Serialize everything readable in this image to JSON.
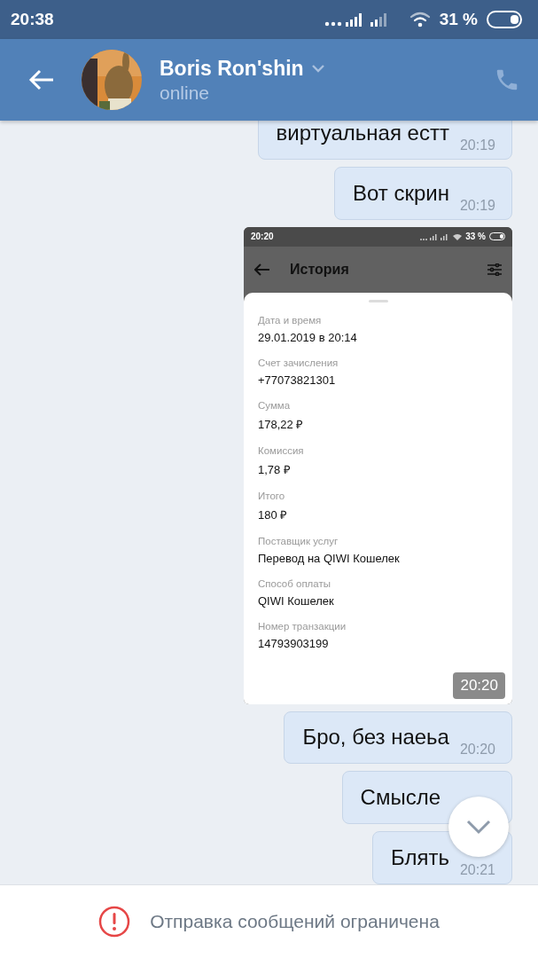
{
  "status_bar": {
    "time": "20:38",
    "battery": "31 %"
  },
  "header": {
    "name": "Boris Ron'shin",
    "status": "online"
  },
  "messages": [
    {
      "kind": "text",
      "text": "виртуальная естт",
      "time": "20:19"
    },
    {
      "kind": "text",
      "text": "Вот скрин",
      "time": "20:19"
    },
    {
      "kind": "screenshot",
      "time": "20:20",
      "screenshot": {
        "status_time": "20:20",
        "battery": "33 %",
        "title": "История",
        "fields": [
          {
            "label": "Дата и время",
            "value": "29.01.2019 в 20:14"
          },
          {
            "label": "Счет зачисления",
            "value": "+77073821301"
          },
          {
            "label": "Сумма",
            "value": "178,22 ₽"
          },
          {
            "label": "Комиссия",
            "value": "1,78 ₽"
          },
          {
            "label": "Итого",
            "value": "180 ₽"
          },
          {
            "label": "Поставщик услуг",
            "value": "Перевод на QIWI Кошелек"
          },
          {
            "label": "Способ оплаты",
            "value": "QIWI Кошелек"
          },
          {
            "label": "Номер транзакции",
            "value": "14793903199"
          }
        ]
      }
    },
    {
      "kind": "text",
      "text": "Бро, без наеьа",
      "time": "20:20"
    },
    {
      "kind": "text",
      "text": "Смысле"
    },
    {
      "kind": "text",
      "text": "Блять",
      "time": "20:21"
    }
  ],
  "notice": "Отправка сообщений ограничена"
}
